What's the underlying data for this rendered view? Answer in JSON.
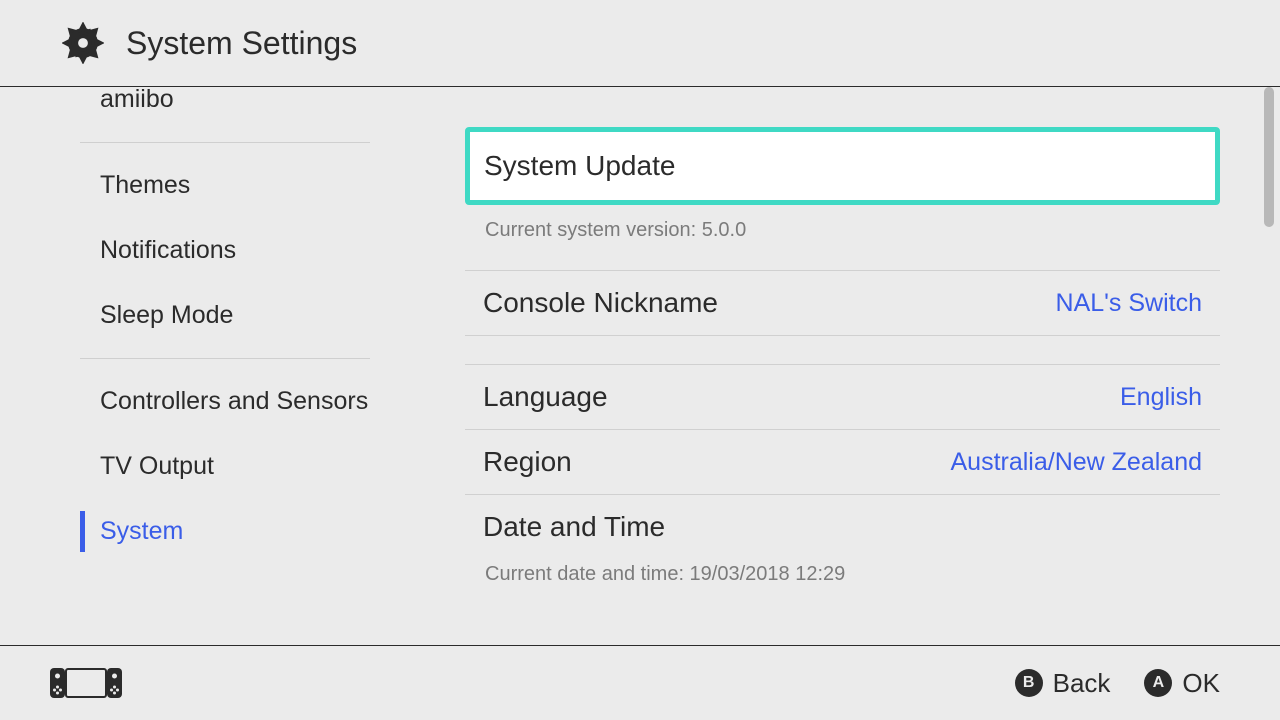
{
  "header": {
    "title": "System Settings"
  },
  "sidebar": {
    "items": [
      {
        "label": "amiibo"
      },
      {
        "label": "Themes"
      },
      {
        "label": "Notifications"
      },
      {
        "label": "Sleep Mode"
      },
      {
        "label": "Controllers and Sensors"
      },
      {
        "label": "TV Output"
      },
      {
        "label": "System"
      }
    ]
  },
  "main": {
    "system_update": {
      "label": "System Update",
      "hint": "Current system version: 5.0.0"
    },
    "console_nickname": {
      "label": "Console Nickname",
      "value": "NAL's Switch"
    },
    "language": {
      "label": "Language",
      "value": "English"
    },
    "region": {
      "label": "Region",
      "value": "Australia/New Zealand"
    },
    "datetime": {
      "label": "Date and Time",
      "hint": "Current date and time: 19/03/2018 12:29"
    }
  },
  "footer": {
    "back": {
      "button": "B",
      "label": "Back"
    },
    "ok": {
      "button": "A",
      "label": "OK"
    }
  }
}
